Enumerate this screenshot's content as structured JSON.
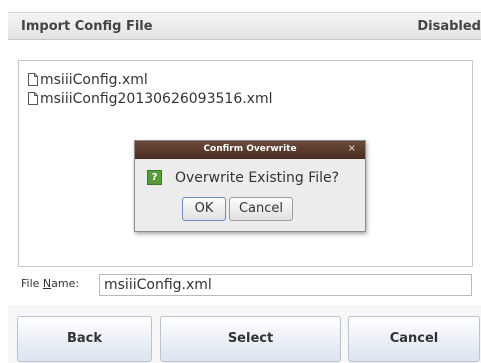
{
  "header": {
    "title": "Import Config File",
    "status": "Disabled"
  },
  "file_list": {
    "items": [
      {
        "name": "msiiiConfig.xml",
        "icon": "file-icon"
      },
      {
        "name": "msiiiConfig20130626093516.xml",
        "icon": "file-icon"
      }
    ]
  },
  "dialog": {
    "title": "Confirm Overwrite",
    "close": "×",
    "question_icon": "?",
    "message": "Overwrite Existing File?",
    "ok_label": "OK",
    "cancel_label": "Cancel"
  },
  "filename": {
    "label_prefix": "File ",
    "label_mnemonic": "N",
    "label_suffix": "ame:",
    "value": "msiiiConfig.xml"
  },
  "buttons": {
    "back": "Back",
    "select": "Select",
    "cancel": "Cancel"
  }
}
